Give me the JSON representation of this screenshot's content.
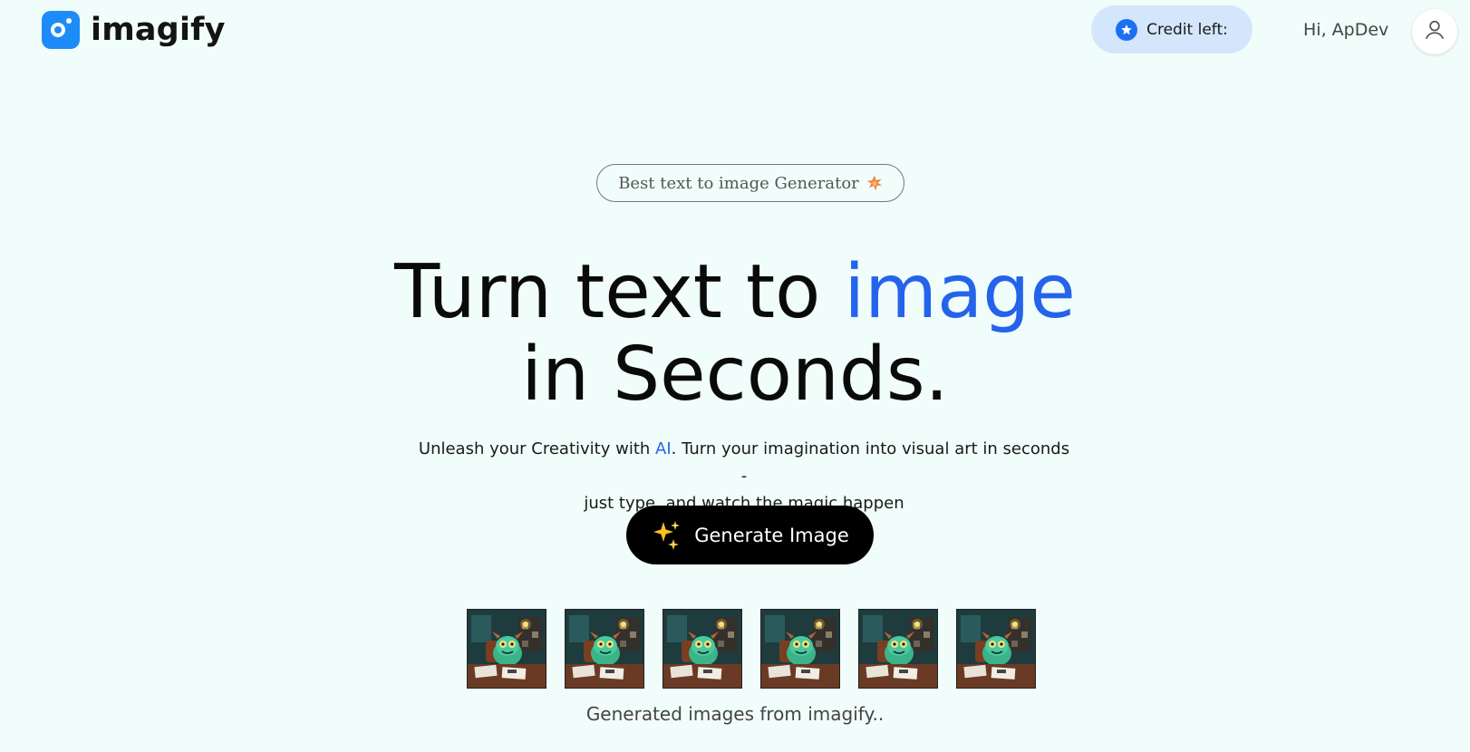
{
  "header": {
    "brand": "imagify",
    "credit_label": "Credit left:",
    "greeting": "Hi, ApDev",
    "icons": {
      "credit": "star-icon",
      "avatar": "user-icon"
    }
  },
  "hero": {
    "badge": "Best text to image Generator",
    "headline": {
      "line1_prefix": "Turn text to ",
      "line1_accent": "image",
      "line2": "in Seconds."
    },
    "subtext": {
      "before_ai": "Unleash your Creativity with ",
      "ai": "AI",
      "after_ai": ". Turn your imagination into visual art in seconds -",
      "line2": "just type, and watch the magic happen"
    },
    "cta_label": "Generate Image"
  },
  "gallery": {
    "thumbnails": [
      {
        "alt": "monster-at-desk-image"
      },
      {
        "alt": "monster-at-desk-image"
      },
      {
        "alt": "monster-at-desk-image"
      },
      {
        "alt": "monster-at-desk-image"
      },
      {
        "alt": "monster-at-desk-image"
      },
      {
        "alt": "monster-at-desk-image"
      }
    ],
    "caption": "Generated images from imagify.."
  },
  "colors": {
    "background": "#f0fdfa",
    "accent": "#2563eb",
    "brand_blue": "#1d8cf8",
    "credit_pill": "#d4e6fb",
    "cta": "#000000"
  }
}
